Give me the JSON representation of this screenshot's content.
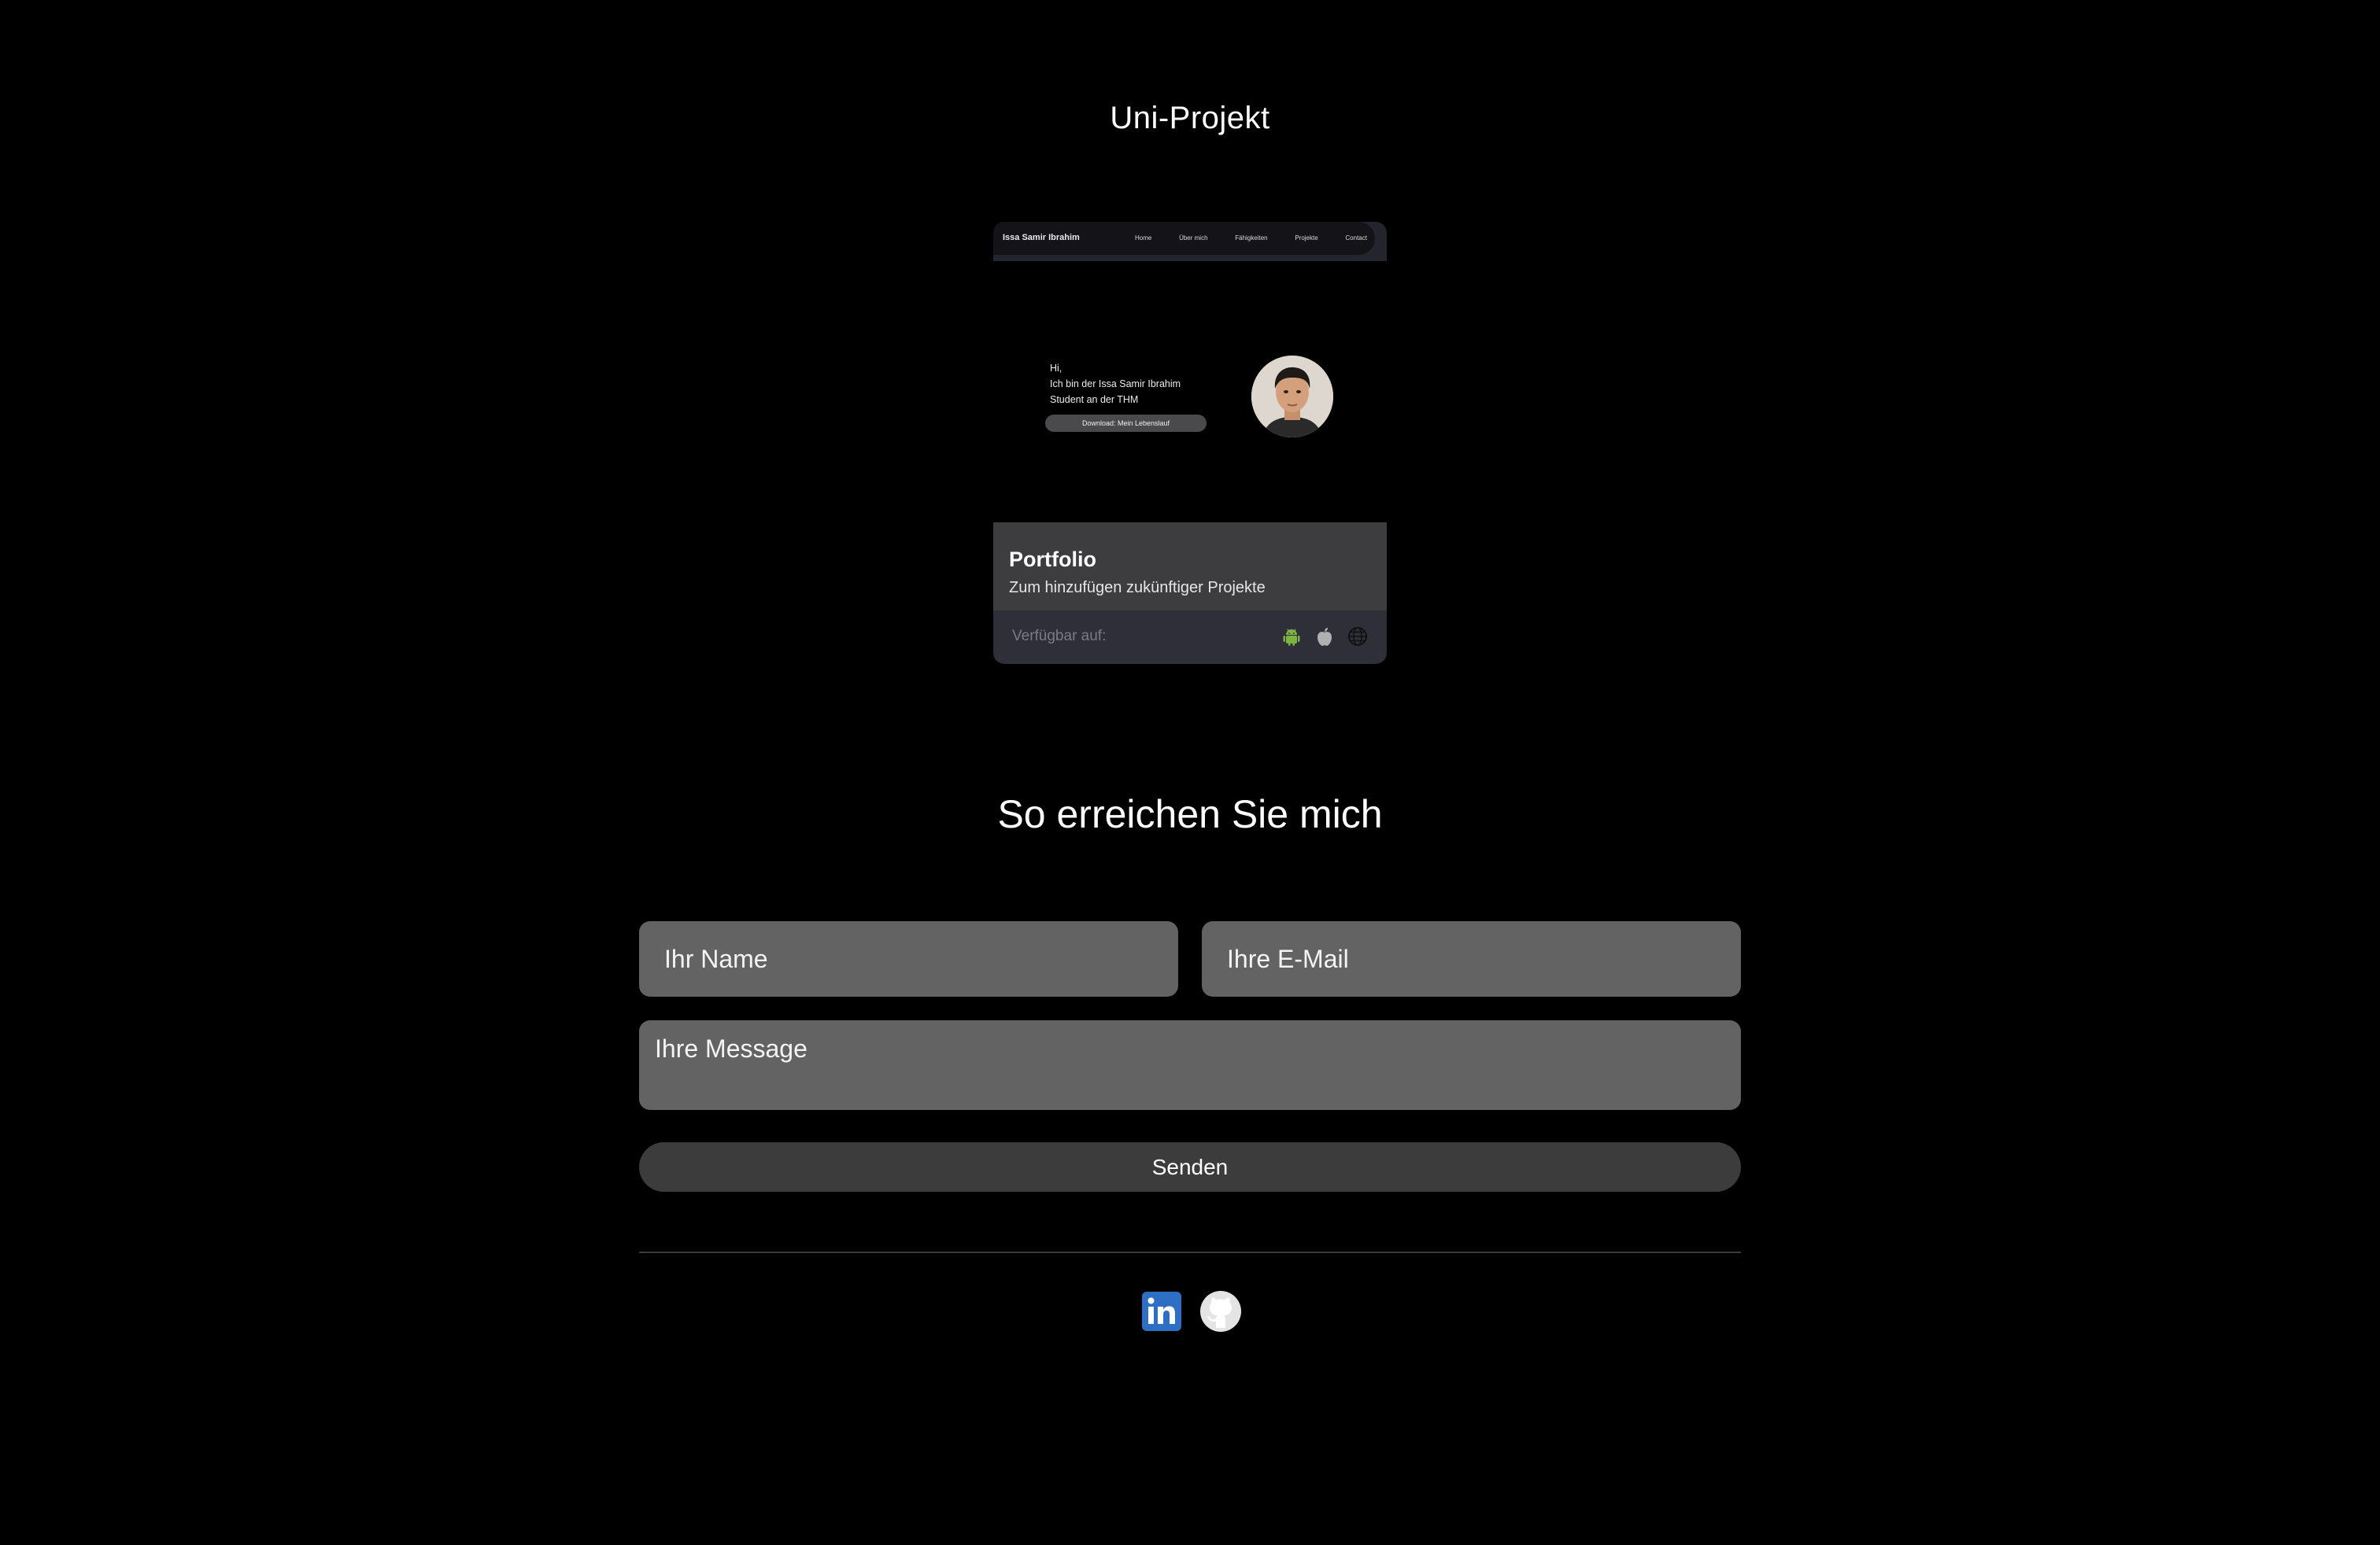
{
  "projects": {
    "title": "Uni-Projekt",
    "card": {
      "preview": {
        "brand": "Issa Samir Ibrahim",
        "nav": [
          "Home",
          "Über mich",
          "Fähigkeiten",
          "Projekte",
          "Contact"
        ],
        "hero_lines": [
          "Hi,",
          "Ich bin der Issa Samir Ibrahim",
          "Student an der THM"
        ],
        "download_button": "Download: Mein Lebenslauf"
      },
      "title": "Portfolio",
      "subtitle": "Zum hinzufügen zukünftiger Projekte",
      "available_label": "Verfügbar auf:",
      "platform_icons": [
        "android-icon",
        "apple-icon",
        "globe-icon"
      ],
      "colors": {
        "info_bg": "#3d3d3f",
        "footer_bg": "#2f2f3a",
        "android": "#7cb342",
        "apple": "#b0b0b0"
      }
    }
  },
  "contact": {
    "title": "So erreichen Sie mich",
    "name_placeholder": "Ihr Name",
    "email_placeholder": "Ihre E-Mail",
    "message_placeholder": "Ihre Message",
    "submit_label": "Senden",
    "colors": {
      "field_bg": "#636363",
      "button_bg": "#3c3c3c"
    }
  },
  "social": {
    "icons": [
      "linkedin-icon",
      "github-icon"
    ],
    "colors": {
      "linkedin": "#2d6fc4",
      "github_bg": "#e4e4e4"
    }
  }
}
